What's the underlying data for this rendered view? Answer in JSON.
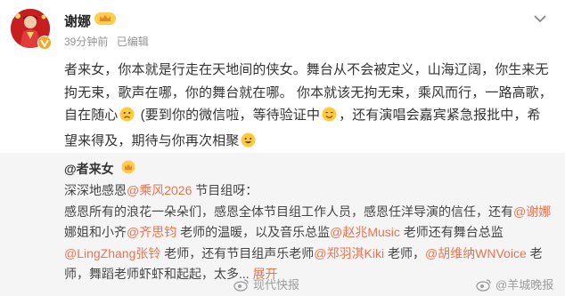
{
  "post": {
    "author": "谢娜",
    "time": "39分钟前",
    "edited": "已编辑",
    "content_parts": [
      "者来女，你本就是行走在天地间的侠女。舞台从不会被定义，山海辽阔，你生来无拘无束，歌声在哪，你的舞台就在哪。 你本就该无拘无束，乘风而行，一路高歌，自在随心",
      " (要到你的微信啦，等待验证中",
      "，还有演唱会嘉宾紧急报批中，希望来得及，期待与你再次相聚",
      ""
    ]
  },
  "repost": {
    "author": "@者来女",
    "line1_pre": "深深地感恩",
    "line1_link": "@乘风2026",
    "line1_post": " 节目组呀：",
    "p1": "感恩所有的浪花一朵朵们，感恩全体节目组工作人员，感恩任洋导演的信任，还有",
    "p2_link": "@谢娜",
    "p3": " 娜姐和小齐",
    "p4_link": "@齐思钧",
    "p5": " 老师的温暖，以及音乐总监",
    "p6_link": "@赵兆Music",
    "p7": " 老师还有舞台总监",
    "p8_link": "@LingZhang张铃",
    "p9": " 老师，还有节目组声乐老师",
    "p10_link": "@郑羽淇Kiki",
    "p11": " 老师，",
    "p12_link": "@胡维纳WNVoice",
    "p13": " 老师，舞蹈老师虾虾和起起，太多",
    "ellipsis": "...",
    "expand": "展开"
  },
  "watermarks": {
    "left": "现代快报",
    "right": "@羊城晚报"
  },
  "colors": {
    "link": "#eb7350",
    "repost_bg": "#f5f5f5",
    "meta": "#939393"
  },
  "icons": [
    "avatar-image",
    "verified-badge-icon",
    "crown-badge-icon",
    "more-chevron-icon",
    "frown-emoji-icon",
    "smile-emoji-icon",
    "grin-emoji-icon",
    "weibo-logo-icon"
  ]
}
